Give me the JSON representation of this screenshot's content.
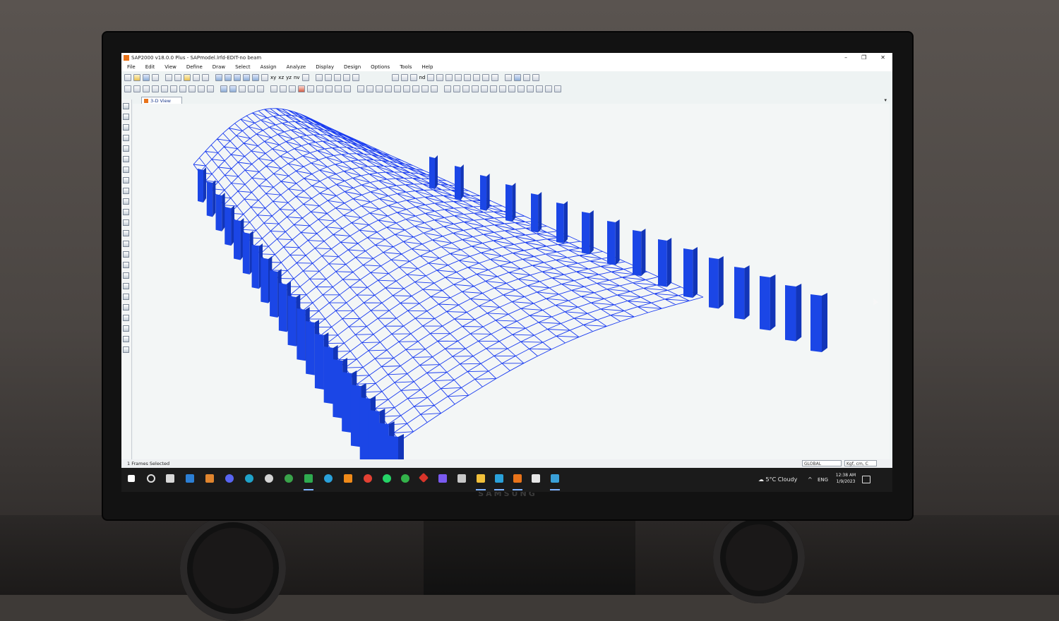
{
  "window": {
    "title": "SAP2000 v18.0.0 Plus - SAPmodel.lrfd-EDIT-no beam",
    "controls": [
      "–",
      "❐",
      "✕"
    ]
  },
  "menu": [
    "File",
    "Edit",
    "View",
    "Define",
    "Draw",
    "Select",
    "Assign",
    "Analyze",
    "Display",
    "Design",
    "Options",
    "Tools",
    "Help"
  ],
  "toolbar_labels": {
    "xy": "xy",
    "xz": "xz",
    "yz": "yz",
    "nv": "nv",
    "nd": "nd"
  },
  "viewport": {
    "tab_label": "3-D View",
    "frame_color": "#1a3cf0",
    "column_color": "#1b46e6"
  },
  "status": {
    "selection": "1 Frames Selected",
    "coord_system": "GLOBAL",
    "units": "Kgf, cm, C"
  },
  "tray": {
    "weather": "5°C  Cloudy",
    "language": "ENG",
    "time": "12:38 AM",
    "date": "1/9/2023"
  },
  "monitor": {
    "brand": "SAMSUNG"
  }
}
